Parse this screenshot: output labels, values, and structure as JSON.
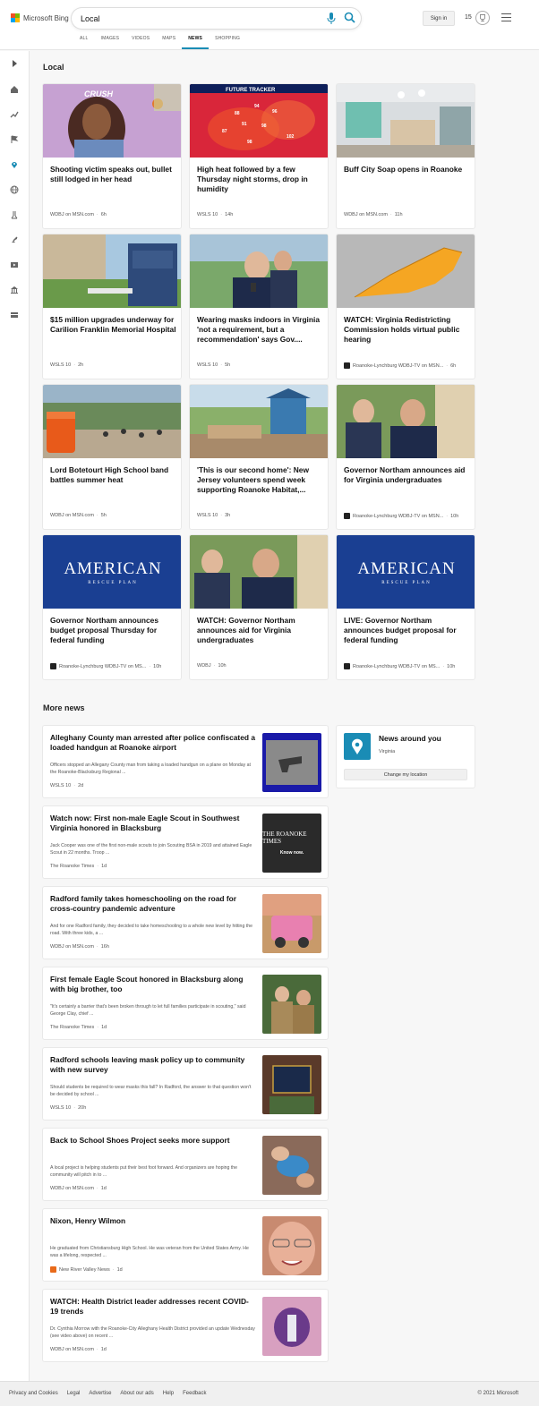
{
  "header": {
    "logo_text": "Microsoft Bing",
    "search_value": "Local",
    "signin_label": "Sign in",
    "points": "15",
    "nav_tabs": [
      "ALL",
      "IMAGES",
      "VIDEOS",
      "MAPS",
      "NEWS",
      "SHOPPING"
    ],
    "active_tab": "NEWS"
  },
  "sidebar": {
    "icons": [
      "expand-icon",
      "home-icon",
      "trending-icon",
      "flag-icon",
      "location-icon",
      "globe-icon",
      "science-icon",
      "rocket-icon",
      "video-icon",
      "bank-icon",
      "card-icon"
    ],
    "active_icon": "location-icon"
  },
  "local": {
    "title": "Local",
    "cards": [
      {
        "title": "Shooting victim speaks out, bullet still lodged in her head",
        "source": "WDBJ on MSN.com",
        "time": "6h",
        "image": "woman-photo",
        "overlay": "CRUSH"
      },
      {
        "title": "High heat followed by a few Thursday night storms, drop in humidity",
        "source": "WSLS 10",
        "time": "14h",
        "image": "weather-map",
        "overlay": "FUTURE TRACKER"
      },
      {
        "title": "Buff City Soap opens in Roanoke",
        "source": "WDBJ on MSN.com",
        "time": "11h",
        "image": "store-interior"
      },
      {
        "title": "$15 million upgrades underway for Carilion Franklin Memorial Hospital",
        "source": "WSLS 10",
        "time": "2h",
        "image": "hospital-sign"
      },
      {
        "title": "Wearing masks indoors in Virginia 'not a requirement, but a recommendation' says Gov....",
        "source": "WSLS 10",
        "time": "5h",
        "image": "governor-photo"
      },
      {
        "title": "WATCH: Virginia Redistricting Commission holds virtual public hearing",
        "source": "Roanoke-Lynchburg WDBJ-TV on MSN...",
        "time": "6h",
        "image": "virginia-map",
        "has_logo": true
      },
      {
        "title": "Lord Botetourt High School band battles summer heat",
        "source": "WDBJ on MSN.com",
        "time": "5h",
        "image": "band-field"
      },
      {
        "title": "'This is our second home': New Jersey volunteers spend week supporting Roanoke Habitat,...",
        "source": "WSLS 10",
        "time": "3h",
        "image": "construction-site"
      },
      {
        "title": "Governor Northam announces aid for Virginia undergraduates",
        "source": "Roanoke-Lynchburg WDBJ-TV on MSN...",
        "time": "10h",
        "image": "governor-photo",
        "has_logo": true
      },
      {
        "title": "Governor Northam announces budget proposal Thursday for federal funding",
        "source": "Roanoke-Lynchburg WDBJ-TV on MS...",
        "time": "10h",
        "image": "american-rescue-plan",
        "has_logo": true
      },
      {
        "title": "WATCH: Governor Northam announces aid for Virginia undergraduates",
        "source": "WDBJ",
        "time": "10h",
        "image": "governor-photo"
      },
      {
        "title": "LIVE: Governor Northam announces budget proposal for federal funding",
        "source": "Roanoke-Lynchburg WDBJ-TV on MS...",
        "time": "10h",
        "image": "american-rescue-plan",
        "has_logo": true
      }
    ],
    "arp_title": "AMERICAN",
    "arp_sub": "RESCUE PLAN"
  },
  "more_news": {
    "title": "More news",
    "items": [
      {
        "title": "Alleghany County man arrested after police confiscated a loaded handgun at Roanoke airport",
        "snippet": "Officers stopped an Allegany County man from taking a loaded handgun on a plane on Monday at the Roanoke-Blacksburg Regional ...",
        "source": "WSLS 10",
        "time": "2d",
        "thumb": "handgun-xray"
      },
      {
        "title": "Watch now: First non-male Eagle Scout in Southwest Virginia honored in Blacksburg",
        "snippet": "Jack Cooper was one of the first non-male scouts to join Scouting BSA in 2019 and attained Eagle Scout in 22 months. Troop ...",
        "source": "The Roanoke Times",
        "time": "1d",
        "thumb": "roanoke-times-logo",
        "thumb_text": "THE ROANOKE TIMES",
        "thumb_sub": "Know now."
      },
      {
        "title": "Radford family takes homeschooling on the road for cross-country pandemic adventure",
        "snippet": "And for one Radford family, they decided to take homeschooling to a whole new level by hitting the road. With three kids, a ...",
        "source": "WDBJ on MSN.com",
        "time": "16h",
        "thumb": "pink-jeep"
      },
      {
        "title": "First female Eagle Scout honored in Blacksburg along with big brother, too",
        "snippet": "\"It's certainly a barrier that's been broken through to let full families participate in scouting,\" said George Clay, chief ...",
        "source": "The Roanoke Times",
        "time": "1d",
        "thumb": "scouts-photo"
      },
      {
        "title": "Radford schools leaving mask policy up to community with new survey",
        "snippet": "Should students be required to wear masks this fall? In Radford, the answer to that question won't be decided by school ...",
        "source": "WSLS 10",
        "time": "20h",
        "thumb": "school-sign"
      },
      {
        "title": "Back to School Shoes Project seeks more support",
        "snippet": "A local project is helping students put their best foot forward. And organizers are hoping the community will pitch in to ...",
        "source": "WDBJ on MSN.com",
        "time": "1d",
        "thumb": "shoes-photo"
      },
      {
        "title": "Nixon, Henry Wilmon",
        "snippet": "He graduated from Christiansburg High School. He was veteran from the United States Army. He was a lifelong, respected ...",
        "source": "New River Valley News",
        "time": "1d",
        "thumb": "portrait-photo",
        "has_logo": true
      },
      {
        "title": "WATCH: Health District leader addresses recent COVID-19 trends",
        "snippet": "Dr. Cynthia Morrow with the Roanoke-City Alleghany Health District provided an update Wednesday (see video above) on recent ...",
        "source": "WDBJ on MSN.com",
        "time": "1d",
        "thumb": "vaccine-photo"
      }
    ]
  },
  "around": {
    "title": "News around you",
    "location": "Virginia",
    "button": "Change my location"
  },
  "footer": {
    "links": [
      "Privacy and Cookies",
      "Legal",
      "Advertise",
      "About our ads",
      "Help",
      "Feedback"
    ],
    "copyright": "© 2021 Microsoft"
  },
  "colors": {
    "accent": "#1a8cb5",
    "arp_blue": "#1a3f92"
  }
}
